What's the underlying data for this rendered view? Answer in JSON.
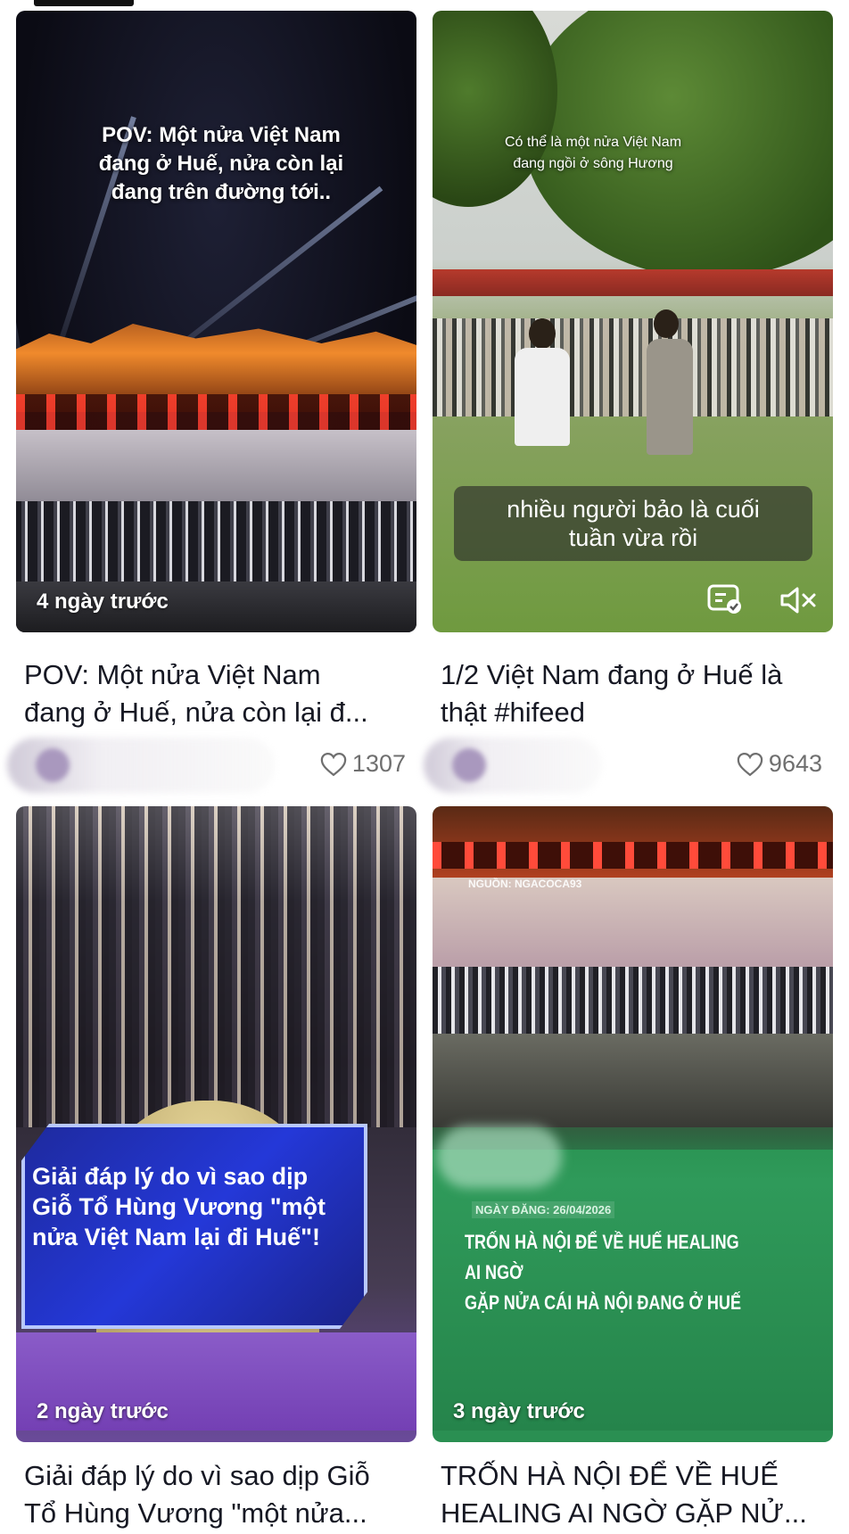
{
  "cards": [
    {
      "overlay": "POV: Một nửa Việt Nam\nđang ở Huế, nửa còn lại\nđang trên đường tới..",
      "time": "4 ngày trước",
      "title_line1": "POV: Một nửa Việt Nam",
      "title_line2": "đang ở Huế, nửa còn lại đ...",
      "likes": "1307"
    },
    {
      "overlay": "Có thể là một nửa Việt Nam\nđang ngồi ở sông Hương",
      "caption": "nhiều người bảo là cuối\ntuần vừa rồi",
      "title_line1": "1/2 Việt Nam đang ở Huế là",
      "title_line2": "thật #hifeed",
      "likes": "9643"
    },
    {
      "panel_text": "Giải đáp lý do vì sao dịp\nGiỗ Tổ Hùng Vương \"một\nnửa Việt Nam lại đi Huế\"!",
      "time": "2 ngày trước",
      "title_line1": "Giải đáp lý do vì sao dịp Giỗ",
      "title_line2": "Tổ Hùng Vương \"một nửa..."
    },
    {
      "source": "NGUỒN: NGACOCA93",
      "date_tag": "NGÀY ĐĂNG: 26/04/2026",
      "headline": "TRỐN HÀ NỘI ĐỂ VỀ HUẾ HEALING AI NGỜ\nGẶP NỬA CÁI HÀ NỘI ĐANG Ở HUẾ",
      "time": "3 ngày trước",
      "title_line1": "TRỐN HÀ NỘI ĐỂ VỀ HUẾ",
      "title_line2": "HEALING AI NGỜ GẶP NỬ..."
    }
  ],
  "icons": {
    "like": "heart-icon",
    "captions": "captions-icon",
    "mute": "mute-icon"
  }
}
